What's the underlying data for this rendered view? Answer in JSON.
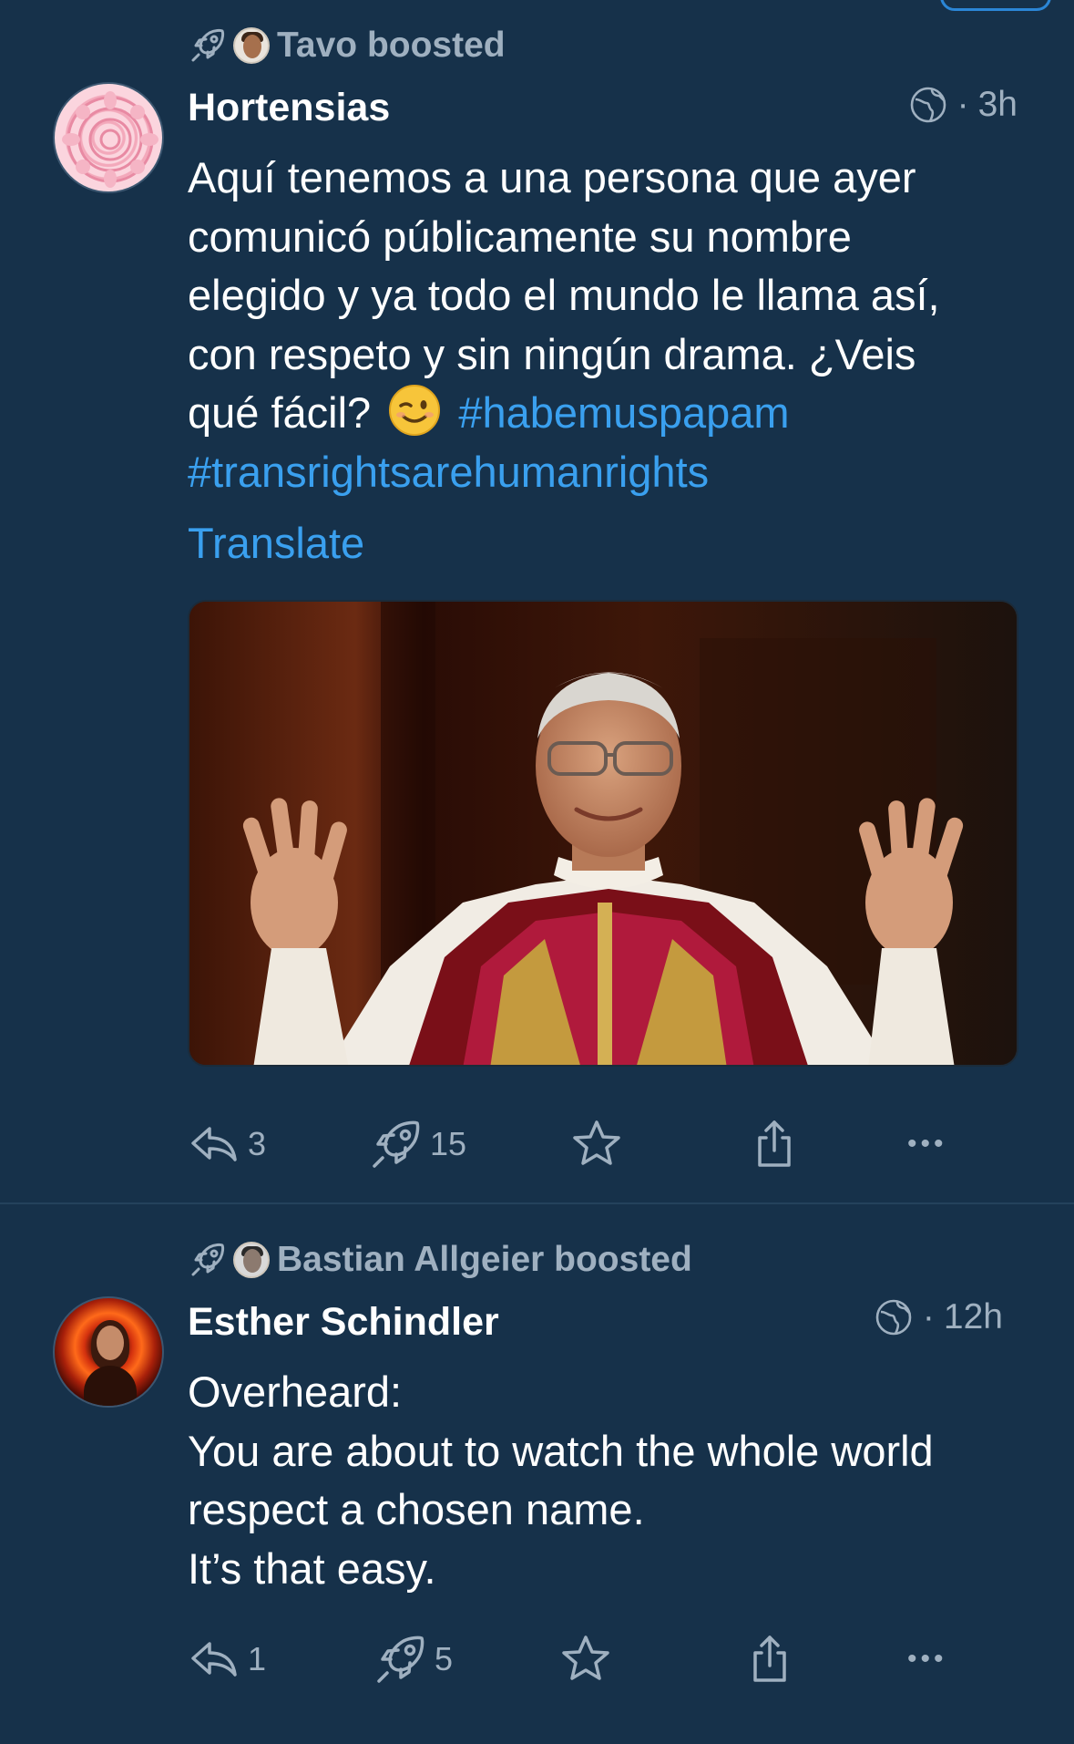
{
  "posts": [
    {
      "boost_text": "Tavo boosted",
      "author": "Hortensias",
      "time": "3h",
      "separator": "·",
      "lines": [
        "Aquí tenemos a una persona que ayer",
        "comunicó públicamente su nombre",
        "elegido y ya todo el mundo le llama así,",
        "con respeto y sin ningún drama. ¿Veis"
      ],
      "line5_text": "qué fácil?",
      "hashtag_1": "#habemuspapam",
      "hashtag_2": "#transrightsarehumanrights",
      "translate_label": "Translate",
      "replies": "3",
      "boosts": "15",
      "favourites": "",
      "more_label": "•••"
    },
    {
      "boost_text": "Bastian Allgeier boosted",
      "author": "Esther Schindler",
      "time": "12h",
      "separator": "·",
      "lines": [
        "Overheard:",
        "You are about to watch the whole world",
        "respect a chosen name.",
        "It’s that easy."
      ],
      "replies": "1",
      "boosts": "5",
      "favourites": "",
      "more_label": "•••"
    }
  ],
  "icons": {
    "boost": "rocket-icon",
    "visibility": "globe-icon",
    "reply": "reply-icon",
    "favourite": "star-icon",
    "share": "share-icon",
    "more": "more-icon"
  },
  "colors": {
    "background": "#16314a",
    "link": "#3aa0ef",
    "muted": "#9fb0c0",
    "text": "#ffffff"
  }
}
